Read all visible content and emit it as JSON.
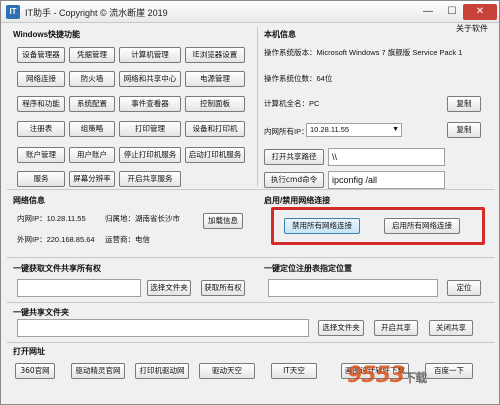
{
  "window": {
    "title": "IT助手 - Copyright © 流水断崖 2019",
    "minimize": "—",
    "maximize": "☐",
    "close": "✕",
    "about": "关于软件"
  },
  "shortcuts": {
    "title": "Windows快捷功能",
    "buttons": [
      "设备管理器",
      "凭据管理",
      "计算机管理",
      "IE浏览器设置",
      "网络连接",
      "防火墙",
      "网络和共享中心",
      "电源管理",
      "程序和功能",
      "系统配置",
      "事件查看器",
      "控制面板",
      "注册表",
      "组策略",
      "打印管理",
      "设备和打印机",
      "账户管理",
      "用户账户",
      "停止打印机服务",
      "启动打印机服务",
      "服务",
      "屏幕分辨率",
      "开启共享服务"
    ]
  },
  "local_info": {
    "title": "本机信息",
    "os_version": "操作系统版本：Microsoft Windows 7 旗舰版  Service Pack 1",
    "os_bits": "操作系统位数：64位",
    "computer_name": "计算机全名：PC",
    "copy1": "复制",
    "internal_ip_label": "内网所有IP：",
    "internal_ip_value": "10.28.11.55",
    "copy2": "复制",
    "open_share_btn": "打开共享路径",
    "share_path": "\\\\",
    "run_cmd_btn": "执行cmd命令",
    "cmd_value": "ipconfig /all"
  },
  "network_info": {
    "title": "网络信息",
    "internal_ip": "内网IP：10.28.11.55",
    "location": "归属地：湖南省长沙市",
    "external_ip": "外网IP：220.168.85.64",
    "isp": "运营商：电信",
    "load_btn": "加载信息"
  },
  "network_toggle": {
    "title": "启用/禁用网络连接",
    "disable_btn": "禁用所有网络连接",
    "enable_btn": "启用所有网络连接"
  },
  "share_perm": {
    "title": "一键获取文件共享所有权",
    "select_btn": "选择文件夹",
    "get_btn": "获取所有权"
  },
  "registry": {
    "title": "一键定位注册表指定位置",
    "locate_btn": "定位"
  },
  "share_folder": {
    "title": "一键共享文件夹",
    "select_btn": "选择文件夹",
    "open_btn": "开启共享",
    "close_btn": "关闭共享"
  },
  "open_urls": {
    "title": "打开网址",
    "buttons": [
      "360官网",
      "驱动精灵官网",
      "打印机驱动网",
      "驱动天空",
      "IT天空",
      "画图设计软件下载",
      "百度一下"
    ]
  },
  "watermark": {
    "text": "9553",
    "sub": "下载"
  },
  "colors": {
    "highlight": "#d42a2a",
    "window_bg": "#f0f0f0"
  }
}
